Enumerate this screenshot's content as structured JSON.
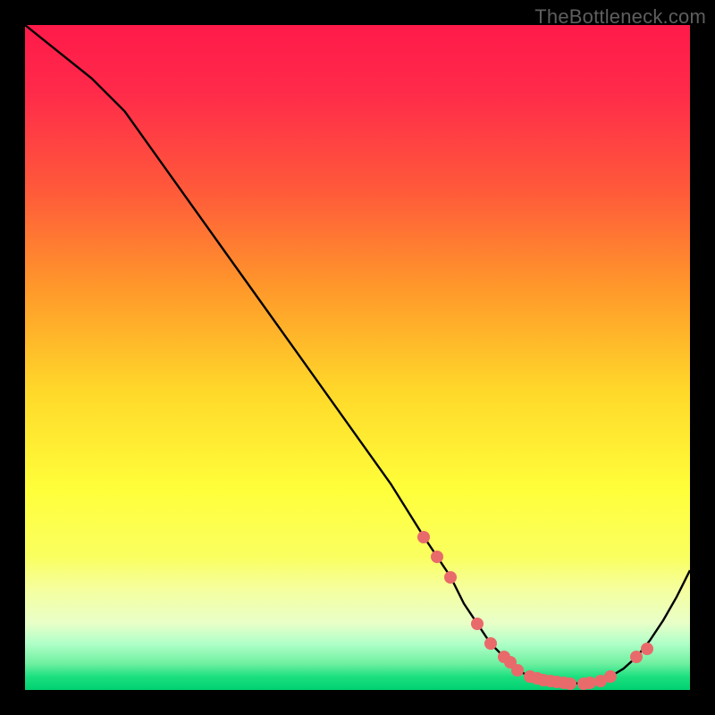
{
  "watermark": "TheBottleneck.com",
  "chart_data": {
    "type": "line",
    "title": "",
    "xlabel": "",
    "ylabel": "",
    "xlim": [
      0,
      100
    ],
    "ylim": [
      0,
      100
    ],
    "series": [
      {
        "name": "curve",
        "x": [
          0,
          5,
          10,
          15,
          20,
          25,
          30,
          35,
          40,
          45,
          50,
          55,
          60,
          62,
          64,
          66,
          68,
          70,
          72,
          74,
          76,
          78,
          80,
          82,
          84,
          86,
          88,
          90,
          92,
          94,
          96,
          98,
          100
        ],
        "y": [
          100,
          96,
          92,
          87,
          80,
          73,
          66,
          59,
          52,
          45,
          38,
          31,
          23,
          20,
          17,
          13,
          10,
          7,
          5,
          3,
          2,
          1.5,
          1.2,
          1.0,
          1.0,
          1.3,
          2.0,
          3.2,
          5.0,
          7.5,
          10.5,
          14,
          18
        ]
      }
    ],
    "marker_points": {
      "name": "salmon-dots",
      "color": "#e96a6a",
      "x": [
        60,
        62,
        64,
        68,
        70,
        72,
        73,
        74,
        76,
        77,
        78,
        79,
        80,
        81,
        82,
        84,
        85,
        86.5,
        88,
        92,
        93.5
      ],
      "y": [
        23,
        20,
        17,
        10,
        7,
        5,
        4.2,
        3,
        2,
        1.8,
        1.5,
        1.3,
        1.2,
        1.1,
        1.0,
        1.0,
        1.1,
        1.4,
        2.0,
        5.0,
        6.2
      ]
    }
  }
}
